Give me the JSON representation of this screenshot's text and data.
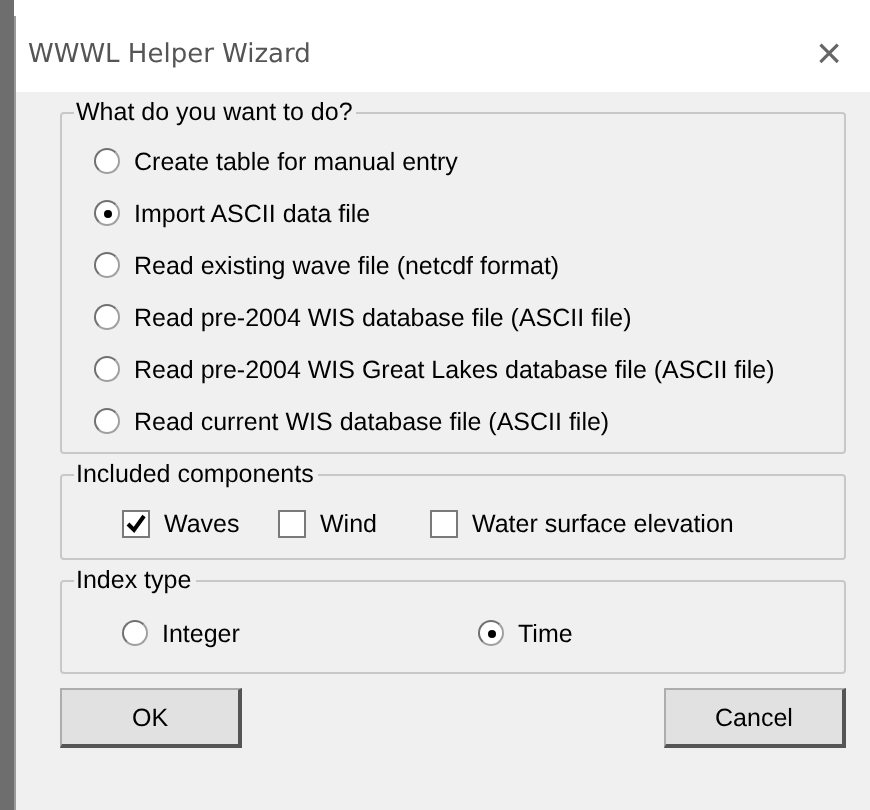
{
  "window": {
    "title": "WWWL Helper Wizard",
    "close": "×"
  },
  "action_group": {
    "title": "What do you want to do?",
    "options": [
      {
        "label": "Create table for manual entry",
        "selected": false
      },
      {
        "label": "Import ASCII data file",
        "selected": true
      },
      {
        "label": "Read existing wave file (netcdf format)",
        "selected": false
      },
      {
        "label": "Read pre-2004 WIS database file (ASCII file)",
        "selected": false
      },
      {
        "label": "Read pre-2004 WIS Great Lakes database file (ASCII file)",
        "selected": false
      },
      {
        "label": "Read current WIS database file (ASCII file)",
        "selected": false
      }
    ]
  },
  "components_group": {
    "title": "Included components",
    "options": [
      {
        "label": "Waves",
        "checked": true
      },
      {
        "label": "Wind",
        "checked": false
      },
      {
        "label": "Water surface elevation",
        "checked": false
      }
    ]
  },
  "index_group": {
    "title": "Index type",
    "options": [
      {
        "label": "Integer",
        "selected": false
      },
      {
        "label": "Time",
        "selected": true
      }
    ]
  },
  "buttons": [
    "OK",
    "Cancel"
  ]
}
